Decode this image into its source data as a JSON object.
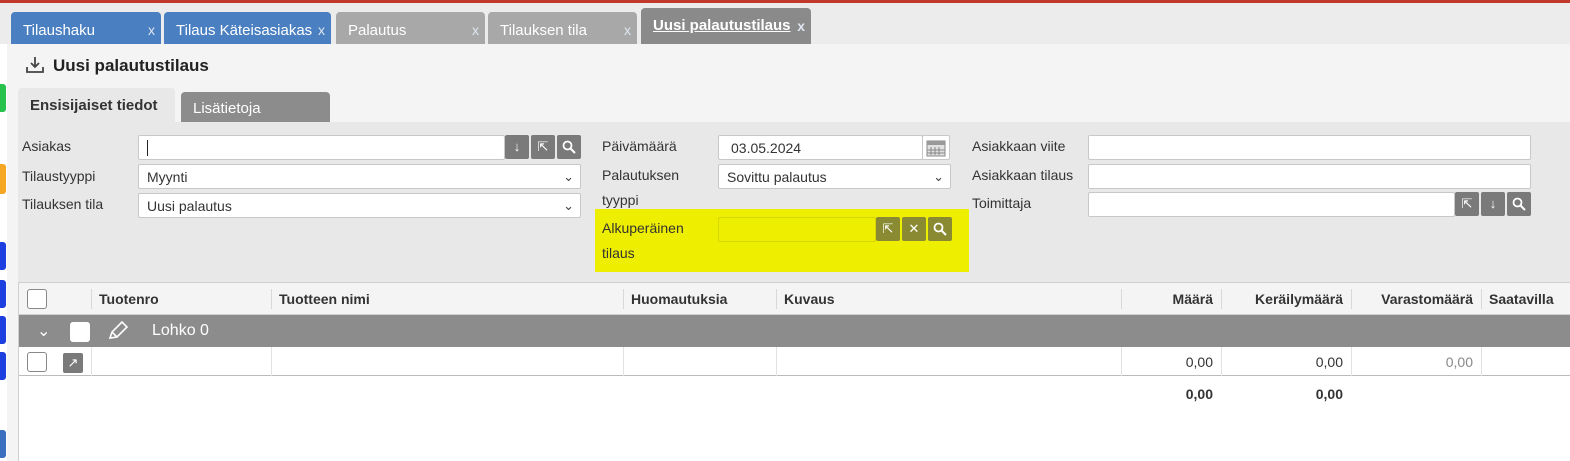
{
  "tabs": [
    {
      "label": "Tilaushaku",
      "close": "x"
    },
    {
      "label": "Tilaus Käteisasiakas",
      "close": "x"
    },
    {
      "label": "Palautus",
      "close": "x"
    },
    {
      "label": "Tilauksen tila",
      "close": "x"
    },
    {
      "label": "Uusi palautustilaus",
      "close": "x"
    }
  ],
  "page": {
    "title": "Uusi palautustilaus",
    "icon": "download-icon"
  },
  "subtabs": {
    "primary": "Ensisijaiset tiedot",
    "secondary": "Lisätietoja"
  },
  "form": {
    "asiakas_label": "Asiakas",
    "asiakas_value": "",
    "tilaustyyppi_label": "Tilaustyyppi",
    "tilaustyyppi_value": "Myynti",
    "tilauksen_tila_label": "Tilauksen tila",
    "tilauksen_tila_value": "Uusi palautus",
    "paivamaara_label": "Päivämäärä",
    "paivamaara_value": "03.05.2024",
    "palautuksen_tyyppi_label_1": "Palautuksen",
    "palautuksen_tyyppi_label_2": "tyyppi",
    "palautuksen_tyyppi_value": "Sovittu palautus",
    "alkuperainen_label_1": "Alkuperäinen",
    "alkuperainen_label_2": "tilaus",
    "alkuperainen_value": "",
    "asiakkaan_viite_label": "Asiakkaan viite",
    "asiakkaan_viite_value": "",
    "asiakkaan_tilaus_label": "Asiakkaan tilaus",
    "asiakkaan_tilaus_value": "",
    "toimittaja_label": "Toimittaja",
    "toimittaja_value": "",
    "highlight_color": "#eeee00"
  },
  "grid": {
    "columns": [
      "Tuotenro",
      "Tuotteen nimi",
      "Huomautuksia",
      "Kuvaus",
      "Määrä",
      "Keräilymäärä",
      "Varastomäärä",
      "Saatavilla"
    ],
    "group_label": "Lohko 0",
    "row": {
      "tuotenro": "",
      "tuotteen_nimi": "",
      "huomautuksia": "",
      "kuvaus": "",
      "maara": "0,00",
      "kerailymaara": "0,00",
      "varastomaara": "0,00"
    },
    "totals": {
      "maara": "0,00",
      "kerailymaara": "0,00"
    }
  },
  "colors": {
    "tab_blue": "#4a7fc1",
    "tab_gray": "#a8a8a8",
    "tab_active": "#8a8a8a",
    "group_bar": "#8c8c8c"
  }
}
